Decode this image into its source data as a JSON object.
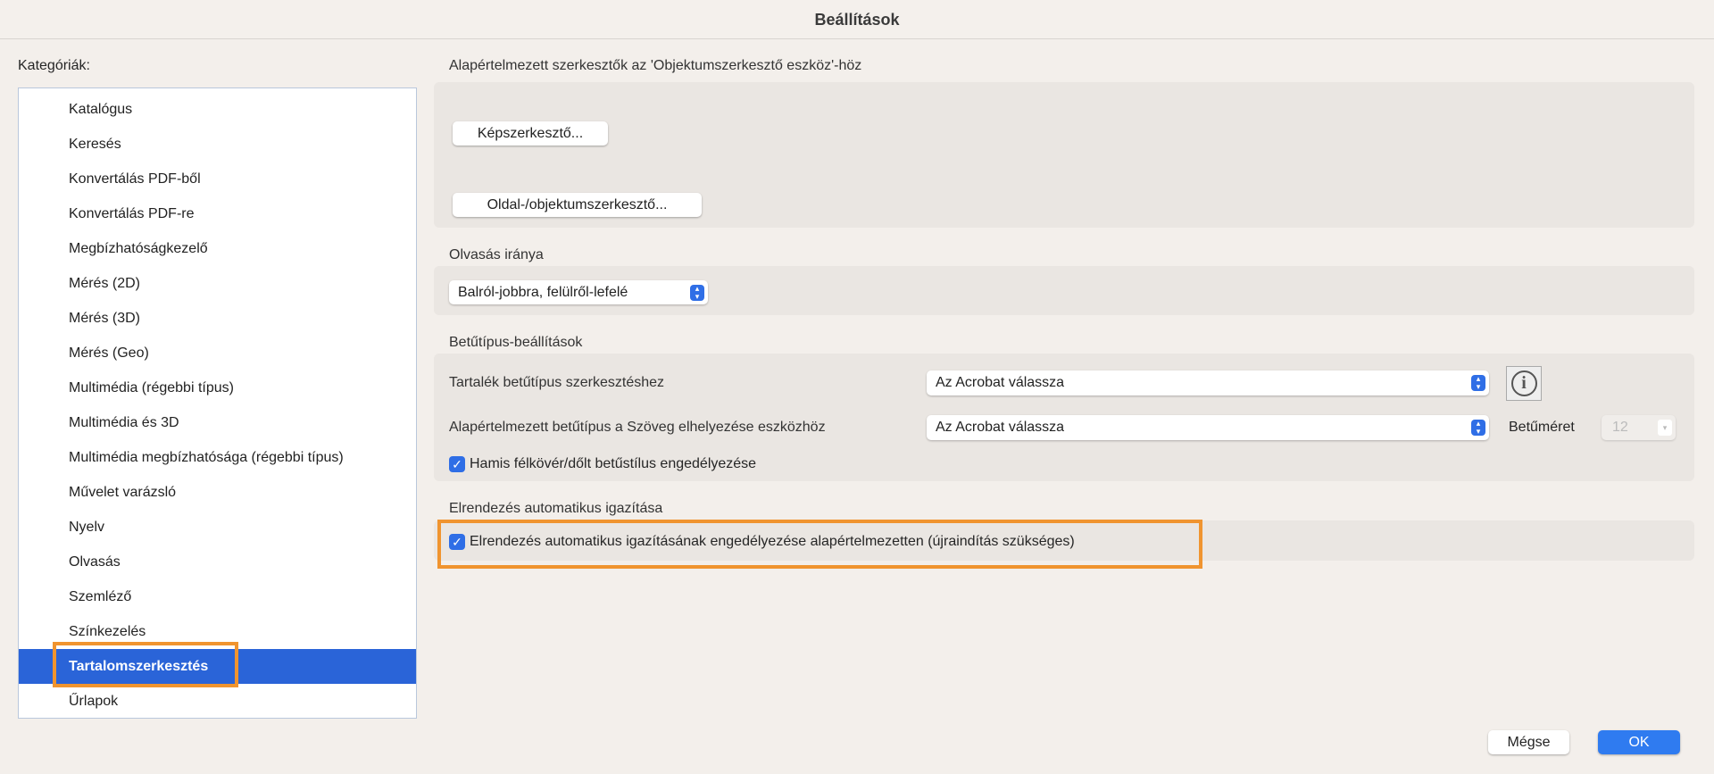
{
  "window": {
    "title": "Beállítások"
  },
  "sidebar": {
    "label": "Kategóriák:",
    "selected_index": 16,
    "items": [
      "Katalógus",
      "Keresés",
      "Konvertálás PDF-ből",
      "Konvertálás PDF-re",
      "Megbízhatóságkezelő",
      "Mérés (2D)",
      "Mérés (3D)",
      "Mérés (Geo)",
      "Multimédia (régebbi típus)",
      "Multimédia és 3D",
      "Multimédia megbízhatósága (régebbi típus)",
      "Művelet varázsló",
      "Nyelv",
      "Olvasás",
      "Szemléző",
      "Színkezelés",
      "Tartalomszerkesztés",
      "Űrlapok"
    ]
  },
  "editors": {
    "heading": "Alapértelmezett szerkesztők az 'Objektumszerkesztő eszköz'-höz",
    "image_button": "Képszerkesztő...",
    "page_button": "Oldal-/objektumszerkesztő..."
  },
  "reading": {
    "heading": "Olvasás iránya",
    "value": "Balról-jobbra, felülről-lefelé"
  },
  "fonts": {
    "heading": "Betűtípus-beállítások",
    "fallback_label": "Tartalék betűtípus szerkesztéshez",
    "fallback_value": "Az Acrobat válassza",
    "default_label": "Alapértelmezett betűtípus a Szöveg elhelyezése eszközhöz",
    "default_value": "Az Acrobat válassza",
    "size_label": "Betűméret",
    "size_value": "12",
    "fake_style_label": "Hamis félkövér/dőlt betűstílus engedélyezése",
    "fake_style_checked": true
  },
  "reflow": {
    "heading": "Elrendezés automatikus igazítása",
    "checkbox_label": "Elrendezés automatikus igazításának engedélyezése alapértelmezetten (újraindítás szükséges)",
    "checked": true
  },
  "footer": {
    "cancel": "Mégse",
    "ok": "OK"
  },
  "colors": {
    "accent": "#2f6ee6",
    "highlight": "#f0942f",
    "selection": "#2a64d8"
  }
}
